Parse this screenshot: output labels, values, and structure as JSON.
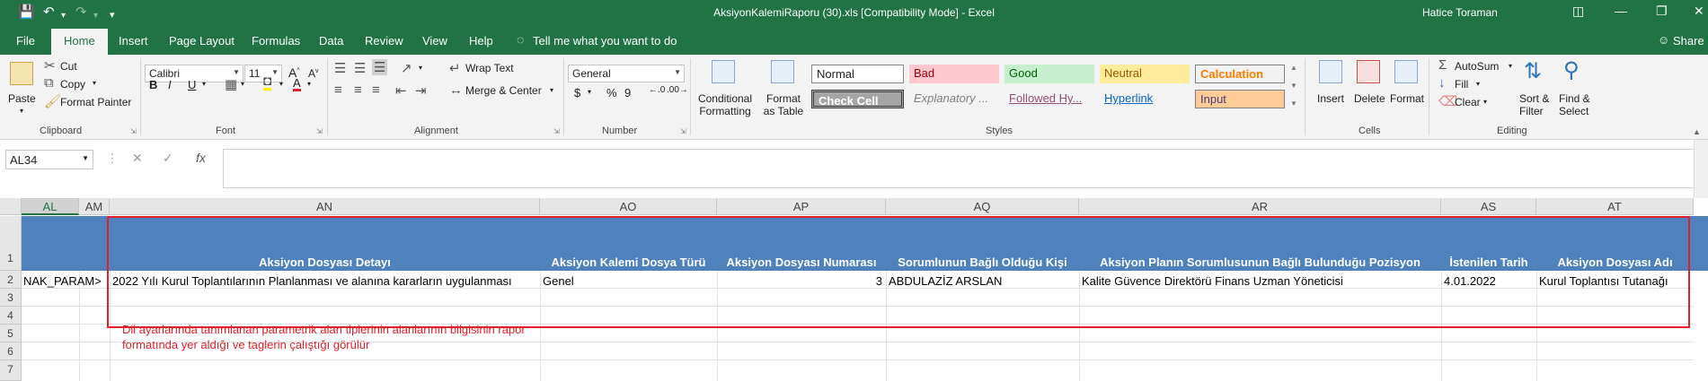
{
  "title_bar": {
    "title": "AksiyonKalemiRaporu (30).xls  [Compatibility Mode]  -  Excel",
    "user": "Hatice Toraman"
  },
  "tabs": [
    "File",
    "Home",
    "Insert",
    "Page Layout",
    "Formulas",
    "Data",
    "Review",
    "View",
    "Help"
  ],
  "tell_me": "Tell me what you want to do",
  "share": "Share",
  "ribbon": {
    "clipboard": {
      "paste": "Paste",
      "cut": "Cut",
      "copy": "Copy",
      "format_painter": "Format Painter",
      "label": "Clipboard"
    },
    "font": {
      "name": "Calibri",
      "size": "11",
      "label": "Font",
      "bold": "B",
      "italic": "I",
      "underline": "U"
    },
    "alignment": {
      "wrap": "Wrap Text",
      "merge": "Merge & Center",
      "label": "Alignment"
    },
    "number": {
      "format": "General",
      "label": "Number",
      "currency": "$",
      "percent": "%",
      "comma": "9"
    },
    "styles": {
      "conditional": "Conditional Formatting",
      "format_as_table": "Format as Table",
      "cells": [
        "Normal",
        "Bad",
        "Good",
        "Neutral",
        "Calculation",
        "Check Cell",
        "Explanatory ...",
        "Followed Hy...",
        "Hyperlink",
        "Input"
      ],
      "label": "Styles"
    },
    "cells_group": {
      "insert": "Insert",
      "delete": "Delete",
      "format": "Format",
      "label": "Cells"
    },
    "editing": {
      "autosum": "AutoSum",
      "fill": "Fill",
      "clear": "Clear",
      "sort": "Sort & Filter",
      "find": "Find & Select",
      "label": "Editing"
    }
  },
  "formula_bar": {
    "name_box": "AL34",
    "fx": "fx",
    "content": ""
  },
  "columns": [
    "AL",
    "AM",
    "AN",
    "AO",
    "AP",
    "AQ",
    "AR",
    "AS",
    "AT"
  ],
  "rows": [
    "1",
    "2",
    "3",
    "4",
    "5",
    "6",
    "7"
  ],
  "header_row": {
    "AN": "Aksiyon Dosyası Detayı",
    "AO": "Aksiyon Kalemi Dosya Türü",
    "AP": "Aksiyon Dosyası Numarası",
    "AQ": "Sorumlunun Bağlı Olduğu Kişi",
    "AR": "Aksiyon Planın Sorumlusunun Bağlı Bulunduğu Pozisyon",
    "AS": "İstenilen Tarih",
    "AT": "Aksiyon Dosyası Adı"
  },
  "data_row": {
    "AL": "NAK_PARAM>",
    "AN": "2022 Yılı Kurul Toplantılarının Planlanması ve alanına kararların uygulanması",
    "AO": "Genel",
    "AP": "3",
    "AQ": "ABDULAZİZ ARSLAN",
    "AR": "Kalite Güvence Direktörü Finans Uzman Yöneticisi",
    "AS": "4.01.2022",
    "AT": "Kurul Toplantısı Tutanağı"
  },
  "annotation": [
    "Dil ayarlarında tanımlanan parametrik alan tiplerinin alanlarının bilgisinin rapor",
    "formatında yer aldığı ve taglerin çalıştığı görülür"
  ],
  "colors": {
    "excel_green": "#217346",
    "header_blue": "#4f81bd",
    "annotation_red": "#e0202a"
  }
}
